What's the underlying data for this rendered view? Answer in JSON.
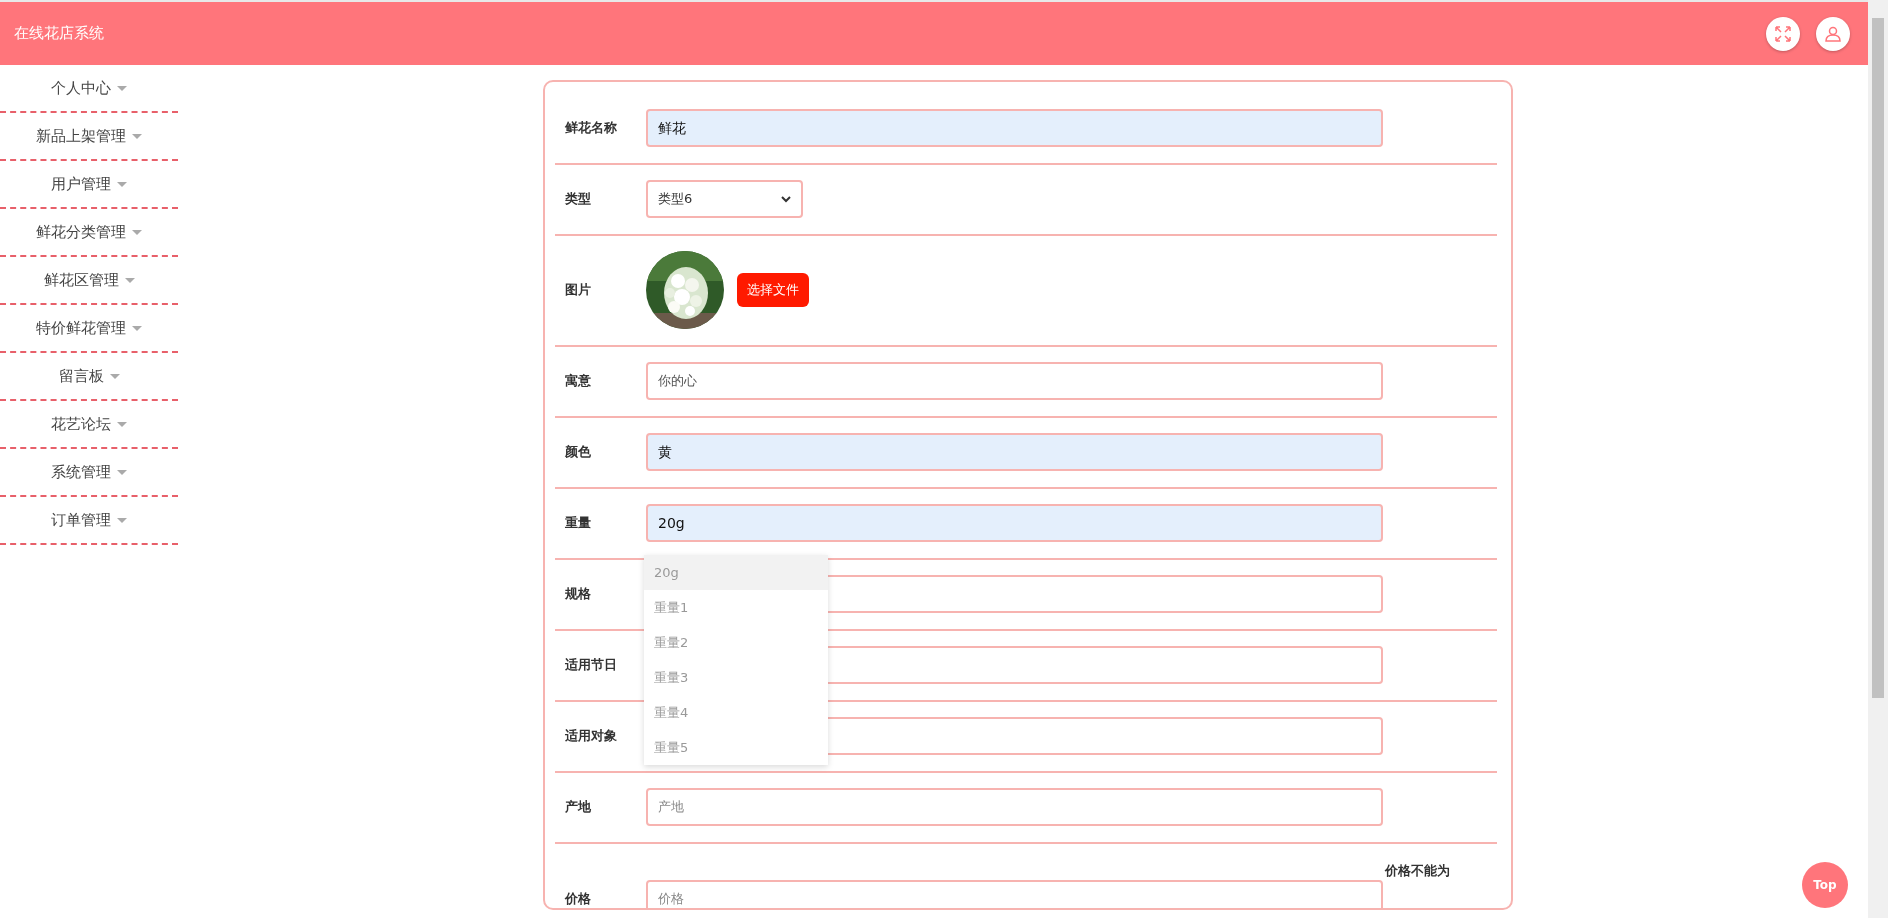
{
  "header": {
    "title": "在线花店系统"
  },
  "sidebar": {
    "items": [
      {
        "label": "个人中心"
      },
      {
        "label": "新品上架管理"
      },
      {
        "label": "用户管理"
      },
      {
        "label": "鲜花分类管理"
      },
      {
        "label": "鲜花区管理"
      },
      {
        "label": "特价鲜花管理"
      },
      {
        "label": "留言板"
      },
      {
        "label": "花艺论坛"
      },
      {
        "label": "系统管理"
      },
      {
        "label": "订单管理"
      }
    ]
  },
  "form": {
    "fields": [
      {
        "kind": "text",
        "label": "鲜花名称",
        "value": "鲜花",
        "autofilled": true
      },
      {
        "kind": "select",
        "label": "类型",
        "value": "类型6"
      },
      {
        "label": "图片",
        "button": "选择文件"
      },
      {
        "kind": "text",
        "label": "寓意",
        "value": "你的心",
        "autofilled": false
      },
      {
        "kind": "text",
        "label": "颜色",
        "value": "黄",
        "autofilled": true
      },
      {
        "kind": "text",
        "label": "重量",
        "value": "20g",
        "autofilled": true
      },
      {
        "kind": "text",
        "label": "规格"
      },
      {
        "kind": "text",
        "label": "适用节日"
      },
      {
        "kind": "text",
        "label": "适用对象"
      },
      {
        "kind": "text",
        "label": "产地",
        "placeholder": "产地"
      },
      {
        "kind": "text",
        "label": "价格",
        "placeholder": "价格",
        "error": "价格不能为"
      }
    ]
  },
  "autocomplete": {
    "items": [
      {
        "label": "20g",
        "selected": true
      },
      {
        "label": "重量1",
        "selected": false
      },
      {
        "label": "重量2",
        "selected": false
      },
      {
        "label": "重量3",
        "selected": false
      },
      {
        "label": "重量4",
        "selected": false
      },
      {
        "label": "重量5",
        "selected": false
      }
    ]
  },
  "top_button": "Top"
}
